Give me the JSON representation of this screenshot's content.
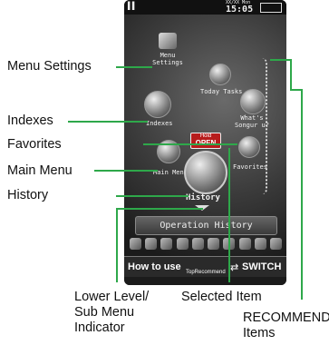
{
  "callouts": {
    "menu_settings": "Menu Settings",
    "indexes": "Indexes",
    "favorites": "Favorites",
    "main_menu": "Main Menu",
    "history": "History",
    "lower_level_line1": "Lower Level/",
    "lower_level_line2": "Sub Menu",
    "lower_level_line3": "Indicator",
    "selected_item": "Selected Item",
    "recommend_line1": "RECOMMEND",
    "recommend_line2": "Items"
  },
  "phone": {
    "status_time": "15:05",
    "status_date": "XX/XX Mon",
    "menu_settings_label": "Menu\nSettings",
    "today_tasks": "Today Tasks",
    "whats_label": "What's\nSongur u?",
    "indexes_label": "Indexes",
    "main_menu_label": "Main Menu",
    "favorites_label": "Favorites",
    "history_label": "History",
    "hold_label": "Hold",
    "open_label": "OPEN",
    "operation_history": "Operation History",
    "softkey_left": "How to use",
    "softkey_middle": "TopRecommend",
    "softkey_right": "SWITCH"
  },
  "colors": {
    "callout_line": "#2ea84a",
    "screen_bg": "#3b3b3b",
    "hold_open_bg": "#b71c1c"
  }
}
